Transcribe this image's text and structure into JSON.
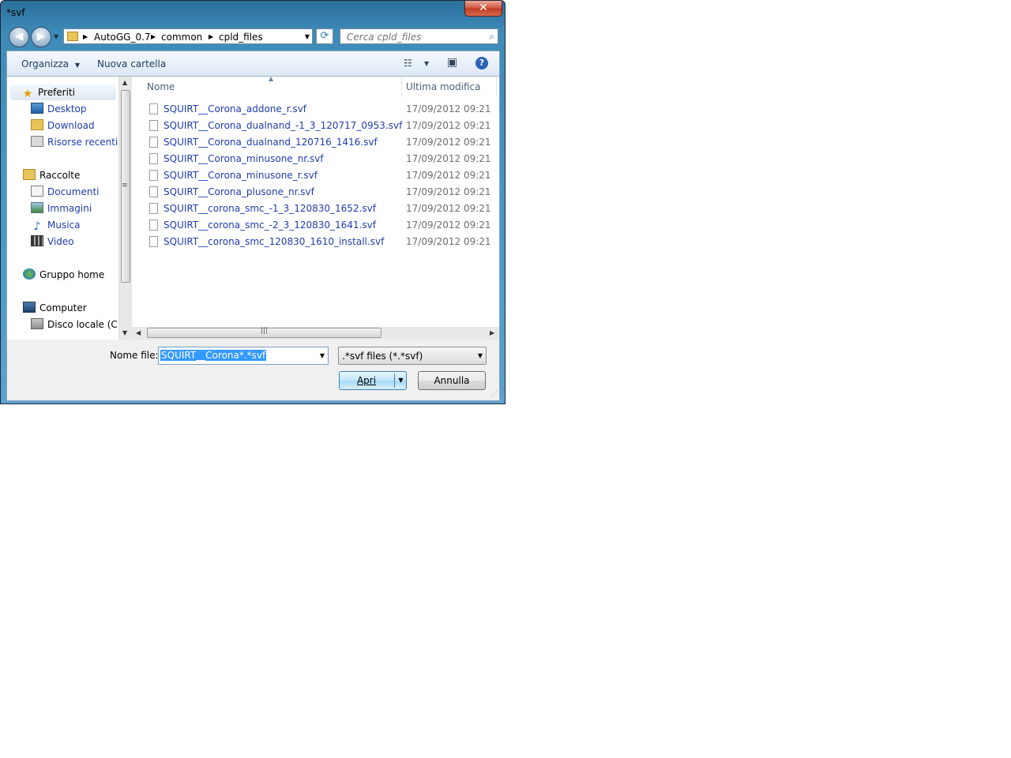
{
  "window": {
    "title": "*svf",
    "close_glyph": "✕"
  },
  "nav": {
    "back_glyph": "◀",
    "forward_glyph": "▶",
    "breadcrumbs": [
      "AutoGG_0.7",
      "common",
      "cpld_files"
    ],
    "refresh_glyph": "⟳",
    "search_placeholder": "Cerca cpld_files",
    "search_glyph": "⌕"
  },
  "toolbar": {
    "organize_label": "Organizza",
    "new_folder_label": "Nuova cartella",
    "view_glyph": "☷",
    "preview_glyph": "▣",
    "help_glyph": "?"
  },
  "tree": {
    "favorites": {
      "label": "Preferiti",
      "icon": "star-icon"
    },
    "favorites_items": [
      {
        "label": "Desktop",
        "icon": "desktop-icon"
      },
      {
        "label": "Download",
        "icon": "download-folder-icon"
      },
      {
        "label": "Risorse recenti",
        "icon": "recent-places-icon"
      }
    ],
    "libraries": {
      "label": "Raccolte",
      "icon": "libraries-icon"
    },
    "libraries_items": [
      {
        "label": "Documenti",
        "icon": "documents-icon"
      },
      {
        "label": "Immagini",
        "icon": "pictures-icon"
      },
      {
        "label": "Musica",
        "icon": "music-icon"
      },
      {
        "label": "Video",
        "icon": "video-icon"
      }
    ],
    "homegroup": {
      "label": "Gruppo home",
      "icon": "homegroup-icon"
    },
    "computer": {
      "label": "Computer",
      "icon": "computer-icon"
    },
    "computer_items": [
      {
        "label": "Disco locale (C:)",
        "icon": "local-disk-icon"
      }
    ]
  },
  "list": {
    "columns": {
      "name": "Nome",
      "modified": "Ultima modifica"
    },
    "files": [
      {
        "name": "SQUIRT__Corona_addone_r.svf",
        "modified": "17/09/2012 09:21"
      },
      {
        "name": "SQUIRT__Corona_dualnand_-1_3_120717_0953.svf",
        "modified": "17/09/2012 09:21"
      },
      {
        "name": "SQUIRT__Corona_dualnand_120716_1416.svf",
        "modified": "17/09/2012 09:21"
      },
      {
        "name": "SQUIRT__Corona_minusone_nr.svf",
        "modified": "17/09/2012 09:21"
      },
      {
        "name": "SQUIRT__Corona_minusone_r.svf",
        "modified": "17/09/2012 09:21"
      },
      {
        "name": "SQUIRT__Corona_plusone_nr.svf",
        "modified": "17/09/2012 09:21"
      },
      {
        "name": "SQUIRT__corona_smc_-1_3_120830_1652.svf",
        "modified": "17/09/2012 09:21"
      },
      {
        "name": "SQUIRT__corona_smc_-2_3_120830_1641.svf",
        "modified": "17/09/2012 09:21"
      },
      {
        "name": "SQUIRT__corona_smc_120830_1610_install.svf",
        "modified": "17/09/2012 09:21"
      }
    ]
  },
  "footer": {
    "filename_label": "Nome file:",
    "filename_value": "SQUIRT__Corona*.*svf",
    "filetype_value": ".*svf files (*.*svf)",
    "open_label": "Apri",
    "cancel_label": "Annulla"
  },
  "colors": {
    "link_text": "#1e3dad",
    "selection": "#3399ff",
    "frame": "#3e8bb8"
  }
}
